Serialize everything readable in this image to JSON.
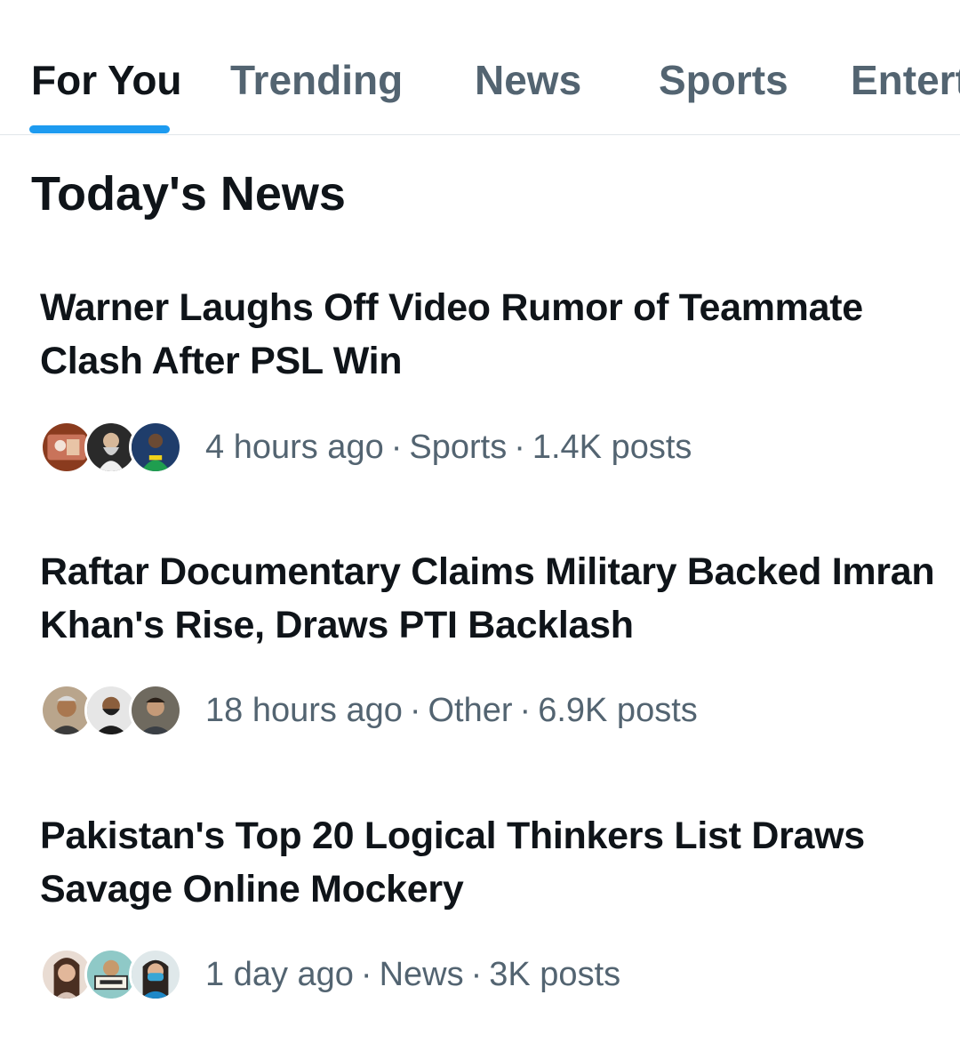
{
  "tabs": [
    {
      "label": "For You",
      "active": true
    },
    {
      "label": "Trending",
      "active": false
    },
    {
      "label": "News",
      "active": false
    },
    {
      "label": "Sports",
      "active": false
    },
    {
      "label": "Entert",
      "active": false
    }
  ],
  "section": {
    "title": "Today's News"
  },
  "news": [
    {
      "headline": "Warner Laughs Off Video Rumor of Teammate Clash After PSL Win",
      "time": "4 hours ago",
      "category": "Sports",
      "posts": "1.4K posts"
    },
    {
      "headline": "Raftar Documentary Claims Military Backed Imran Khan's Rise, Draws PTI Backlash",
      "time": "18 hours ago",
      "category": "Other",
      "posts": "6.9K posts"
    },
    {
      "headline": "Pakistan's Top 20 Logical Thinkers List Draws Savage Online Mockery",
      "time": "1 day ago",
      "category": "News",
      "posts": "3K posts"
    }
  ],
  "meta_separator": "·",
  "colors": {
    "accent": "#1d9bf0",
    "text_primary": "#0f1419",
    "text_secondary": "#536471",
    "divider": "#e1e6ea"
  }
}
